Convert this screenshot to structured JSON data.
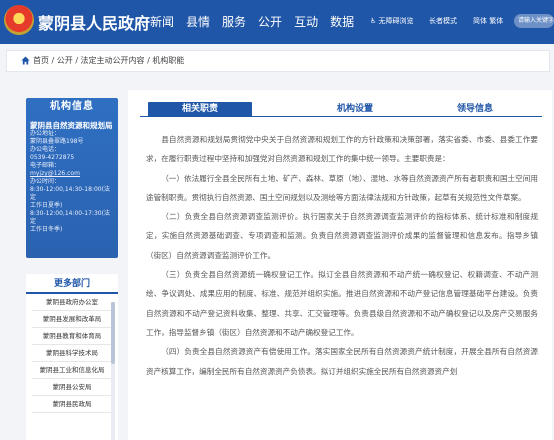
{
  "header": {
    "site_title": "蒙阴县人民政府",
    "nav": [
      "新闻",
      "县情",
      "服务",
      "公开",
      "互动",
      "数据"
    ],
    "accessibility": "♿ 无障碍浏览",
    "elder_mode": "长者模式",
    "language": "简体 繁体",
    "search_placeholder": "请输入关键字"
  },
  "breadcrumb": "首页 / 公开 / 法定主动公开内容 / 机构职能",
  "sidebar": {
    "info_title": "机构信息",
    "org_name": "蒙阴县自然资源和规划局",
    "lines": [
      "办公地址：",
      "蒙阴县叠翠路198号",
      "办公电话：",
      "0539-4272875",
      "电子邮箱：",
      "myjzy@126.com",
      "办公时间：",
      "8:30-12:00,14:30-18:00(法定",
      "工作日夏季)",
      "8:30-12:00,14:00-17:30(法定",
      "工作日冬季)"
    ],
    "dept_title": "更多部门",
    "depts": [
      "蒙阴县政府办公室",
      "蒙阴县发展和改革局",
      "蒙阴县教育和体育局",
      "蒙阴县科学技术局",
      "蒙阴县工业和信息化局",
      "蒙阴县公安局",
      "蒙阴县民政局"
    ]
  },
  "tabs": [
    "相关职责",
    "机构设置",
    "领导信息"
  ],
  "paragraphs": [
    "县自然资源和规划局贯彻党中央关于自然资源和规划工作的方针政策和决策部署，落实省委、市委、县委工作要求，在履行职责过程中坚持和加强党对自然资源和规划工作的集中统一领导。主要职责是：",
    "（一）依法履行全县全民所有土地、矿产、森林、草原（地）、湿地、水等自然资源资产所有者职责和国土空间用途管制职责。贯彻执行自然资源、国土空间规划以及测绘等方面法律法规和方针政策，起草有关规范性文件草案。",
    "（二）负责全县自然资源调查监测评价。执行国家关于自然资源调查监测评价的指标体系、统计标准和制度规定，实施自然资源基础调查、专项调查和监测。负责自然资源调查监测评价成果的监督管理和信息发布。指导乡镇（街区）自然资源调查监测评价工作。",
    "（三）负责全县自然资源统一确权登记工作。拟订全县自然资源和不动产统一确权登记、权籍调查、不动产测绘、争议调处、成果应用的制度、标准、规范并组织实施。推进自然资源和不动产登记信息管理基础平台建设。负责自然资源和不动产登记资料收集、整理、共享、汇交管理等。负责县级自然资源和不动产确权登记以及房产交易服务工作，指导监督乡镇（街区）自然资源和不动产确权登记工作。",
    "（四）负责全县自然资源资产有偿使用工作。落实国家全民所有自然资源资产统计制度，开展全县所有自然资源资产核算工作，编制全民所有自然资源资产负债表。拟订并组织实施全民所有自然资源资产划"
  ]
}
